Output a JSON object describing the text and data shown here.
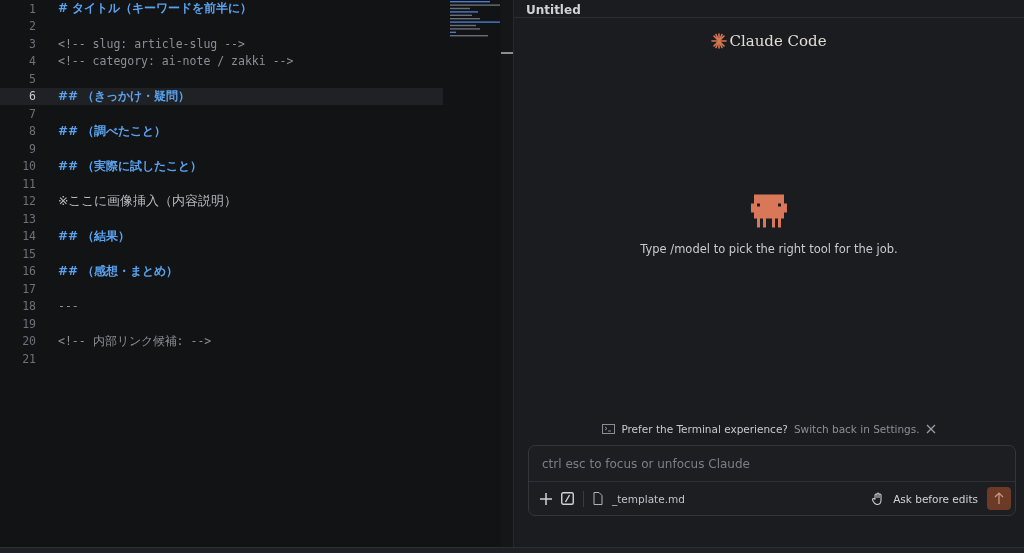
{
  "editor": {
    "lines": [
      {
        "number": "1",
        "kind": "heading",
        "text": "# タイトル（キーワードを前半に）",
        "current": false
      },
      {
        "number": "2",
        "kind": "blank",
        "current": false
      },
      {
        "number": "3",
        "kind": "comment",
        "text": "<!-- slug: article-slug -->",
        "current": false
      },
      {
        "number": "4",
        "kind": "comment",
        "text": "<!-- category: ai-note / zakki -->",
        "current": false
      },
      {
        "number": "5",
        "kind": "blank",
        "current": false
      },
      {
        "number": "6",
        "kind": "heading",
        "text": "## （きっかけ・疑問）",
        "current": true
      },
      {
        "number": "7",
        "kind": "blank",
        "current": false
      },
      {
        "number": "8",
        "kind": "heading",
        "text": "## （調べたこと）",
        "current": false
      },
      {
        "number": "9",
        "kind": "blank",
        "current": false
      },
      {
        "number": "10",
        "kind": "heading",
        "text": "## （実際に試したこと）",
        "current": false
      },
      {
        "number": "11",
        "kind": "blank",
        "current": false
      },
      {
        "number": "12",
        "kind": "text",
        "text": "※ここに画像挿入（内容説明）",
        "current": false
      },
      {
        "number": "13",
        "kind": "blank",
        "current": false
      },
      {
        "number": "14",
        "kind": "heading",
        "text": "## （結果）",
        "current": false
      },
      {
        "number": "15",
        "kind": "blank",
        "current": false
      },
      {
        "number": "16",
        "kind": "heading",
        "text": "## （感想・まとめ）",
        "current": false
      },
      {
        "number": "17",
        "kind": "blank",
        "current": false
      },
      {
        "number": "18",
        "kind": "comment",
        "text": "---",
        "current": false
      },
      {
        "number": "19",
        "kind": "blank",
        "current": false
      },
      {
        "number": "20",
        "kind": "comment",
        "text": "<!-- 内部リンク候補: -->",
        "current": false
      },
      {
        "number": "21",
        "kind": "blank",
        "current": false
      }
    ]
  },
  "panel": {
    "title": "Untitled",
    "logo": "Claude Code",
    "tip": "Type /model to pick the right tool for the job.",
    "notice": {
      "lead": "Prefer the Terminal experience?",
      "link": "Switch back in Settings."
    },
    "input": {
      "placeholder": "ctrl esc to focus or unfocus Claude",
      "file": "_template.md",
      "mode": "Ask before edits"
    }
  }
}
